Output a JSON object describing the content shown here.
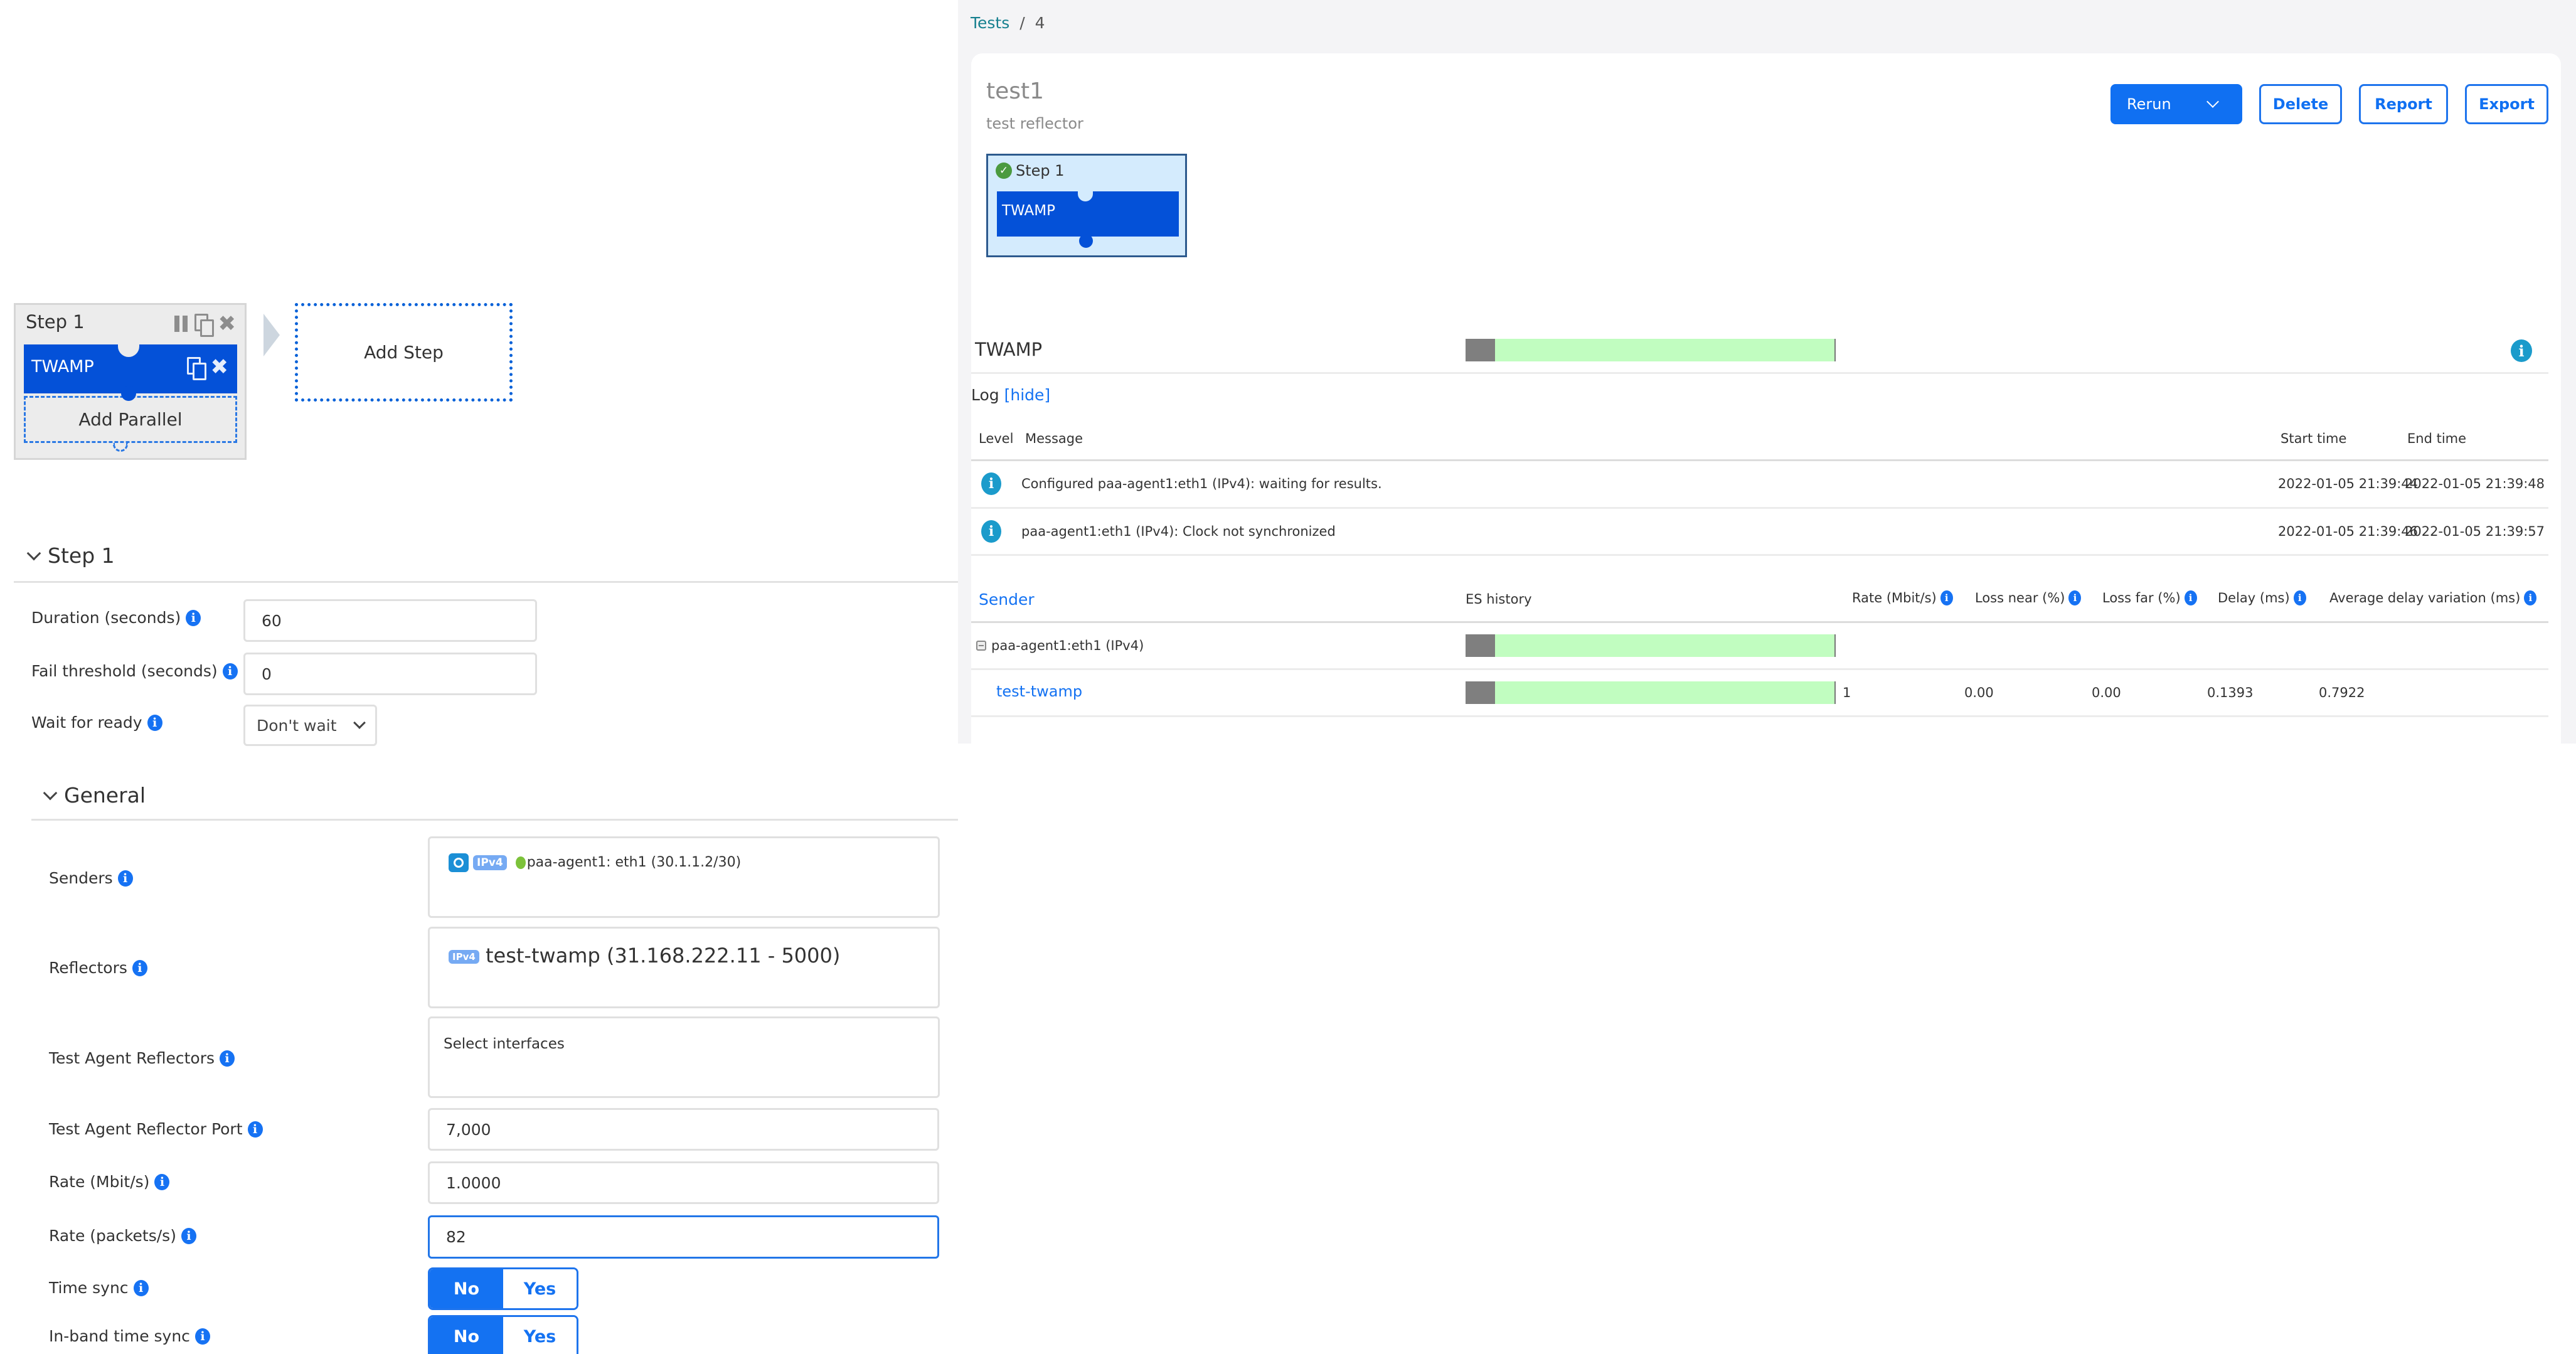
{
  "builder": {
    "step_title": "Step 1",
    "task_label": "TWAMP",
    "add_parallel_label": "Add Parallel",
    "add_step_label": "Add Step"
  },
  "step_section": {
    "title": "Step 1",
    "fields": {
      "duration": {
        "label": "Duration (seconds)",
        "value": "60"
      },
      "fail_threshold": {
        "label": "Fail threshold (seconds)",
        "value": "0"
      },
      "wait_for_ready": {
        "label": "Wait for ready",
        "value": "Don't wait"
      }
    }
  },
  "general_section": {
    "title": "General",
    "senders": {
      "label": "Senders",
      "tag": "IPv4",
      "agent_status": "online",
      "value": "paa-agent1: eth1  (30.1.1.2/30)"
    },
    "reflectors": {
      "label": "Reflectors",
      "tag": "IPv4",
      "value": "test-twamp (31.168.222.11 - 5000)"
    },
    "test_agent_reflectors": {
      "label": "Test Agent Reflectors",
      "placeholder": "Select interfaces"
    },
    "test_agent_reflector_port": {
      "label": "Test Agent Reflector Port",
      "value": "7,000"
    },
    "rate_mbit": {
      "label": "Rate (Mbit/s)",
      "value": "1.0000"
    },
    "rate_packets": {
      "label": "Rate (packets/s)",
      "value": "82"
    },
    "time_sync": {
      "label": "Time sync",
      "options": [
        "No",
        "Yes"
      ],
      "selected": "No"
    },
    "inband_time_sync": {
      "label": "In-band time sync",
      "options": [
        "No",
        "Yes"
      ],
      "selected": "No"
    }
  },
  "results": {
    "breadcrumb": {
      "root": "Tests",
      "separator": "/",
      "current": "4"
    },
    "title": "test1",
    "subtitle": "test reflector",
    "buttons": {
      "rerun": "Rerun",
      "delete": "Delete",
      "report": "Report",
      "export": "Export"
    },
    "run_step": {
      "title": "Step 1",
      "status": "passed",
      "task": "TWAMP"
    },
    "task_row": {
      "name": "TWAMP",
      "es_history": {
        "errored_fraction": 0.08,
        "ok_fraction": 0.92
      }
    },
    "log": {
      "title": "Log",
      "toggle": "[hide]",
      "columns": [
        "Level",
        "Message",
        "Start time",
        "End time"
      ],
      "rows": [
        {
          "level": "info",
          "message": "Configured paa-agent1:eth1 (IPv4): waiting for results.",
          "start": "2022-01-05 21:39:44",
          "end": "2022-01-05 21:39:48"
        },
        {
          "level": "info",
          "message": "paa-agent1:eth1 (IPv4): Clock not synchronized",
          "start": "2022-01-05 21:39:46",
          "end": "2022-01-05 21:39:57"
        }
      ]
    },
    "streams": {
      "columns": [
        "Sender",
        "ES history",
        "Rate (Mbit/s)",
        "Loss near (%)",
        "Loss far (%)",
        "Delay (ms)",
        "Average delay variation (ms)"
      ],
      "group": {
        "name": "paa-agent1:eth1 (IPv4)",
        "es_history": {
          "errored_fraction": 0.08,
          "ok_fraction": 0.92
        }
      },
      "rows": [
        {
          "name": "test-twamp",
          "es_history": {
            "errored_fraction": 0.08,
            "ok_fraction": 0.92
          },
          "rate": "1",
          "loss_near": "0.00",
          "loss_far": "0.00",
          "delay": "0.1393",
          "avg_delay_variation": "0.7922"
        }
      ]
    }
  },
  "colors": {
    "primary": "#1070f2",
    "task_block": "#0451d8",
    "es_ok": "#c1fdc0",
    "es_errored": "#7f7f7f",
    "info_teal": "#1b9bcb",
    "status_pass": "#4b9a3f"
  }
}
